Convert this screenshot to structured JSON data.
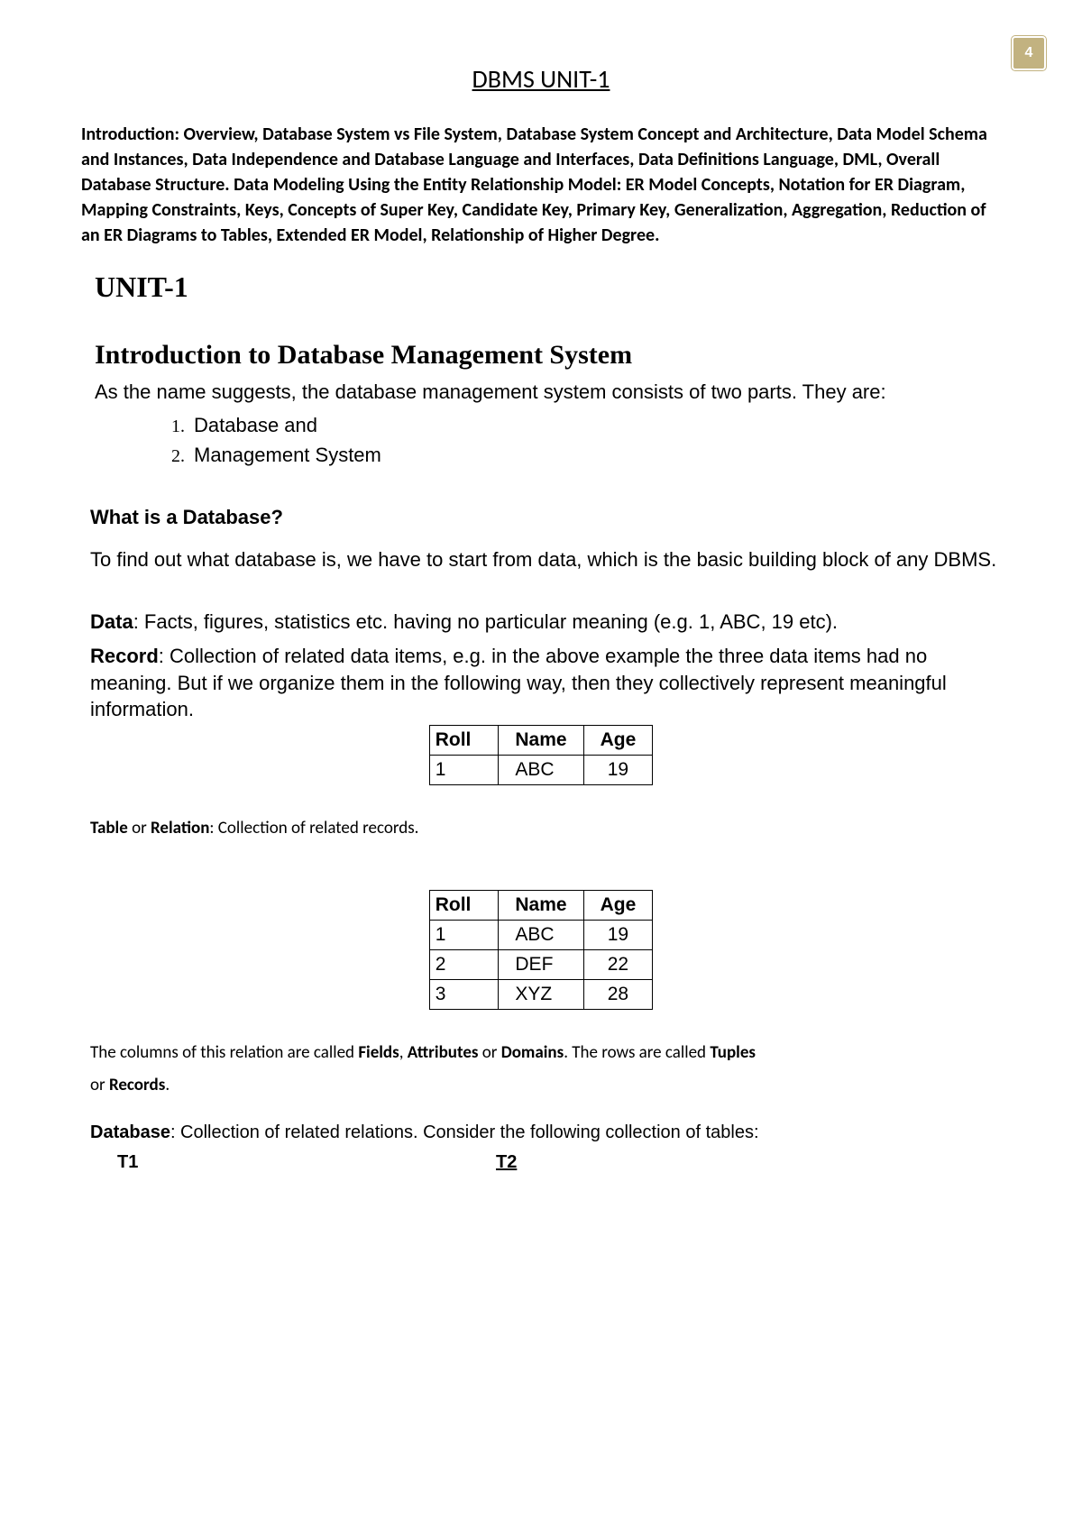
{
  "page_number": "4",
  "doc_title": "DBMS UNIT-1",
  "intro_block": "Introduction: Overview, Database System vs File System, Database System Concept and Architecture, Data Model Schema and Instances, Data Independence and Database Language and Interfaces, Data Definitions Language, DML, Overall Database Structure. Data Modeling Using the Entity Relationship Model: ER Model Concepts, Notation for ER Diagram, Mapping Constraints, Keys, Concepts of Super Key, Candidate Key, Primary Key, Generalization, Aggregation, Reduction of an ER Diagrams to Tables, Extended ER Model, Relationship of Higher Degree.",
  "unit_heading": "UNIT-1",
  "section_heading": "Introduction to Database Management System",
  "intro_sentence": "As the name suggests, the database management system consists of two parts. They are:",
  "list_items": [
    "Database and",
    "Management System"
  ],
  "sub_heading": "What is a Database?",
  "paragraph1": "To find out what database is, we have to start from data, which is the basic building block of any DBMS.",
  "data_label": "Data",
  "data_def": ": Facts, figures, statistics etc. having no particular meaning (e.g. 1, ABC, 19 etc).",
  "record_label": "Record",
  "record_def": ": Collection of related data items, e.g. in the above example the three data items had no meaning. But if we organize them in the following way, then they collectively represent meaningful information.",
  "table1": {
    "headers": [
      "Roll",
      "Name",
      "Age"
    ],
    "rows": [
      [
        "1",
        "ABC",
        "19"
      ]
    ]
  },
  "table_label1": "Table",
  "table_or": " or ",
  "table_label2": "Relation",
  "table_def": ": Collection of related records.",
  "table2": {
    "headers": [
      "Roll",
      "Name",
      "Age"
    ],
    "rows": [
      [
        "1",
        "ABC",
        "19"
      ],
      [
        "2",
        "DEF",
        "22"
      ],
      [
        "3",
        "XYZ",
        "28"
      ]
    ]
  },
  "columns_text_pre": "The columns of this relation are called ",
  "fields_label": "Fields",
  "comma_sep": ", ",
  "attributes_label": "Attributes",
  "or_sep": " or ",
  "domains_label": "Domains",
  "rows_text_pre": ". The rows are called ",
  "tuples_label": "Tuples",
  "or_word": "or ",
  "records_label": "Records",
  "period": ".",
  "database_label": "Database",
  "database_def": ": Collection of related relations. Consider the following collection of tables:",
  "t1_label": "T1",
  "t2_label": "T2"
}
